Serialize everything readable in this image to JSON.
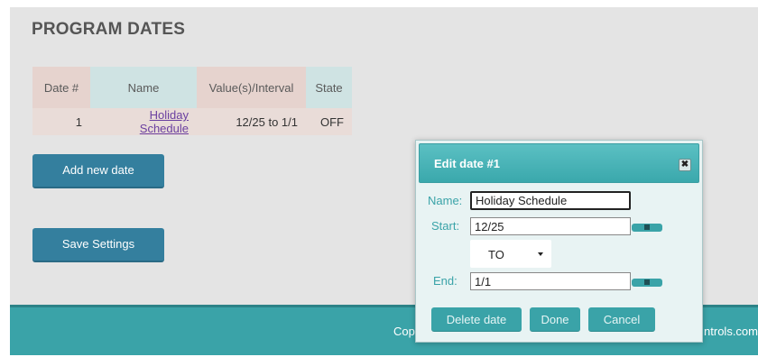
{
  "page": {
    "title": "PROGRAM DATES"
  },
  "table": {
    "headers": [
      "Date #",
      "Name",
      "Value(s)/Interval",
      "State"
    ],
    "rows": [
      {
        "num": "1",
        "name": "Holiday Schedule",
        "interval": "12/25 to 1/1",
        "state": "OFF"
      }
    ]
  },
  "buttons": {
    "add_new_date": "Add new date",
    "save_settings": "Save Settings"
  },
  "footer": {
    "left_text": "Cop",
    "right_text": "ntrols.com"
  },
  "modal": {
    "title": "Edit date #1",
    "close_glyph": "✖",
    "name_label": "Name:",
    "name_value": "Holiday Schedule",
    "start_label": "Start:",
    "start_value": "12/25",
    "mode_value": "TO",
    "end_label": "End:",
    "end_value": "1/1",
    "delete_label": "Delete date",
    "done_label": "Done",
    "cancel_label": "Cancel"
  },
  "colors": {
    "accent": "#3aa3a8",
    "primary_button": "#347f9e",
    "link": "#6a3fa0"
  }
}
